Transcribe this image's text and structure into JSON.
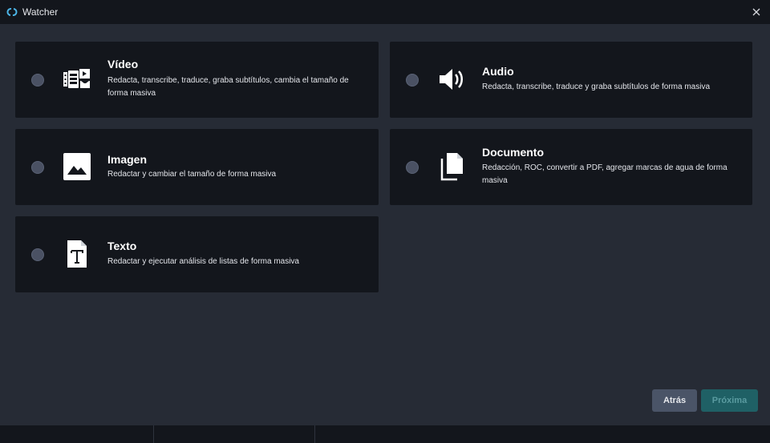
{
  "window": {
    "title": "Watcher",
    "accent": "#4cb6e8"
  },
  "cards": [
    {
      "id": "video",
      "title": "Vídeo",
      "description": "Redacta, transcribe, traduce, graba subtítulos, cambia el tamaño de forma masiva",
      "icon": "video-icon"
    },
    {
      "id": "audio",
      "title": "Audio",
      "description": "Redacta, transcribe, traduce y graba subtítulos de forma masiva",
      "icon": "speaker-icon"
    },
    {
      "id": "imagen",
      "title": "Imagen",
      "description": "Redactar y cambiar el tamaño de forma masiva",
      "icon": "image-icon"
    },
    {
      "id": "documento",
      "title": "Documento",
      "description": "Redacción, ROC, convertir a PDF, agregar marcas de agua de forma masiva",
      "icon": "documents-icon"
    },
    {
      "id": "texto",
      "title": "Texto",
      "description": "Redactar y ejecutar análisis de listas de forma masiva",
      "icon": "text-file-icon"
    }
  ],
  "footer": {
    "back_label": "Atrás",
    "next_label": "Próxima"
  }
}
